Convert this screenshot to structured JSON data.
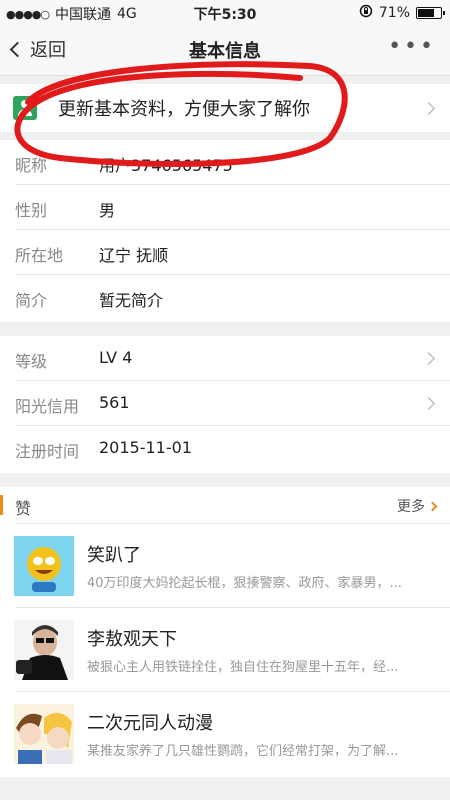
{
  "status_bar": {
    "signal": "●●●●○",
    "carrier": "中国联通",
    "network": "4G",
    "time": "下午5:30",
    "lock_icon": "rotation-lock-icon",
    "battery_text": "71%",
    "battery_level": 0.71
  },
  "nav": {
    "back_label": "返回",
    "title": "基本信息",
    "more_icon": "more-icon"
  },
  "promo": {
    "text": "更新基本资料，方便大家了解你",
    "icon": "contact-icon",
    "icon_color": "#2fa45d"
  },
  "profile": {
    "rows": [
      {
        "label": "昵称",
        "value": "用户3746565475"
      },
      {
        "label": "性别",
        "value": "男"
      },
      {
        "label": "所在地",
        "value": "辽宁 抚顺"
      },
      {
        "label": "简介",
        "value": "暂无简介"
      }
    ]
  },
  "account": {
    "rows": [
      {
        "label": "等级",
        "value": "LV 4"
      },
      {
        "label": "阳光信用",
        "value": "561"
      },
      {
        "label": "注册时间",
        "value": "2015-11-01"
      }
    ]
  },
  "likes": {
    "title": "赞",
    "more_label": "更多",
    "accent": "#f08a1a",
    "items": [
      {
        "title": "笑趴了",
        "desc": "40万印度大妈抡起长棍，狠揍警察、政府、家暴男，..."
      },
      {
        "title": "李敖观天下",
        "desc": "被狠心主人用铁链拴住，独自住在狗屋里十五年，经..."
      },
      {
        "title": "二次元同人动漫",
        "desc": "某推友家养了几只雄性鹦鹉，它们经常打架，为了解..."
      }
    ]
  },
  "annotation_color": "#e11b1b"
}
